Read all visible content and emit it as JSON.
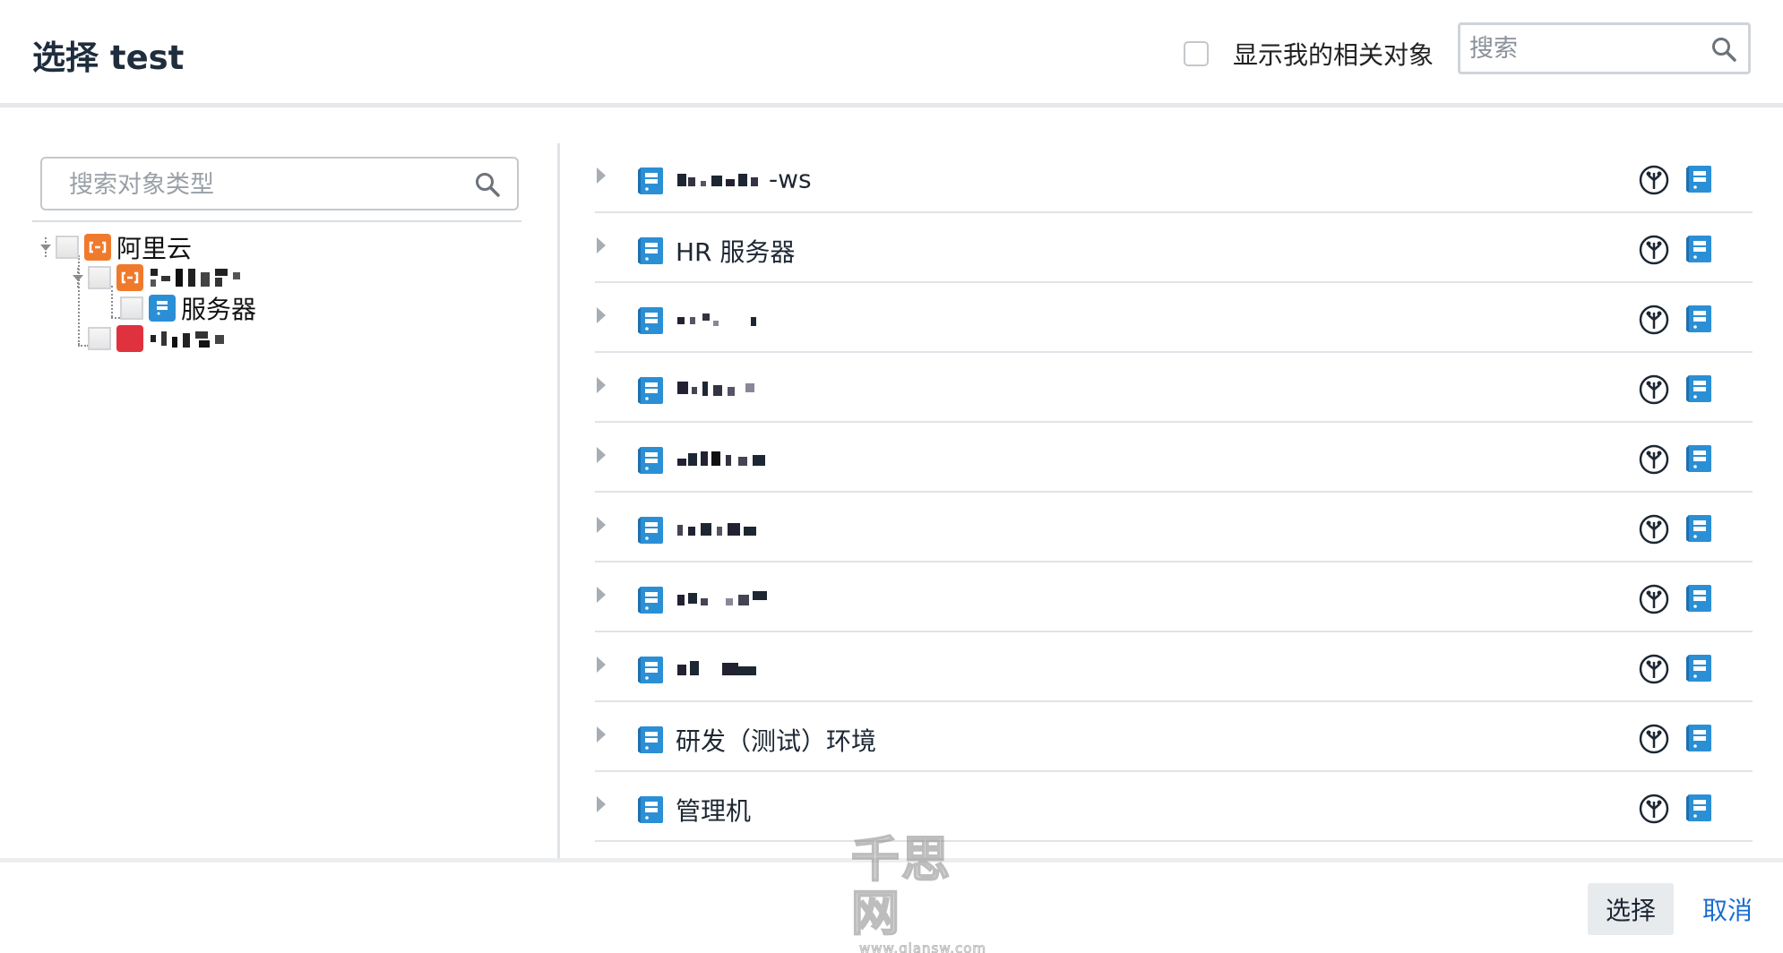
{
  "header": {
    "title": "选择 test",
    "related_checkbox_label": "显示我的相关对象",
    "related_checked": false,
    "search_placeholder": "搜索"
  },
  "left_panel": {
    "type_search_placeholder": "搜索对象类型",
    "tree": [
      {
        "label": "阿里云",
        "icon": "aliyun-icon",
        "level": 0
      },
      {
        "label": "",
        "icon": "aliyun-icon",
        "level": 1,
        "pixelated": true
      },
      {
        "label": "服务器",
        "icon": "server-icon",
        "level": 2
      },
      {
        "label": "",
        "icon": "red-cloud-icon",
        "level": 1,
        "pixelated": true
      }
    ]
  },
  "objects": [
    {
      "label": "-ws",
      "pixel_prefix": true
    },
    {
      "label": "HR 服务器",
      "pixel_prefix": false
    },
    {
      "label": "",
      "pixel_prefix": true
    },
    {
      "label": "",
      "pixel_prefix": true
    },
    {
      "label": "",
      "pixel_prefix": true
    },
    {
      "label": "",
      "pixel_prefix": true
    },
    {
      "label": "",
      "pixel_prefix": true
    },
    {
      "label": "",
      "pixel_prefix": true
    },
    {
      "label": "研发（测试）环境",
      "pixel_prefix": false
    },
    {
      "label": "管理机",
      "pixel_prefix": false
    }
  ],
  "footer": {
    "select_label": "选择",
    "cancel_label": "取消"
  },
  "watermark": {
    "main": "千思网",
    "sub": "www.qiansw.com"
  },
  "colors": {
    "accent": "#1a6dd0",
    "server_blue": "#2b8fd6",
    "aliyun_orange": "#f07a2c"
  }
}
